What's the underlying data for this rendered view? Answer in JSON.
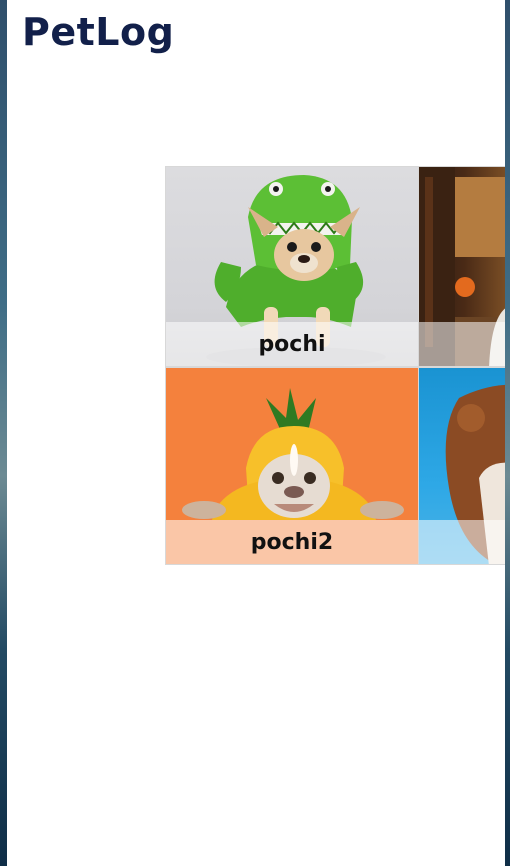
{
  "app": {
    "title": "PetLog"
  },
  "pets": [
    {
      "name": "pochi"
    },
    {
      "name": ""
    },
    {
      "name": "pochi2"
    },
    {
      "name": ""
    }
  ],
  "colors": {
    "title": "#12204a",
    "photo_1_background": "#d8d8dc",
    "photo_3_background": "#f4813d",
    "photo_4_background": "#2ea8e6"
  }
}
